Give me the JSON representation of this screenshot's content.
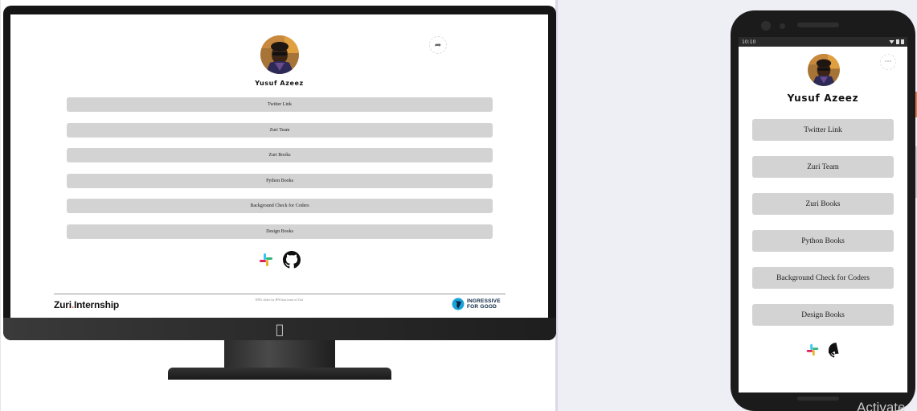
{
  "profile": {
    "name": "Yusuf Azeez"
  },
  "links": [
    {
      "label": "Twitter Link"
    },
    {
      "label": "Zuri Team"
    },
    {
      "label": "Zuri Books"
    },
    {
      "label": "Python Books"
    },
    {
      "label": "Background Check for Coders"
    },
    {
      "label": "Design Books"
    }
  ],
  "socials": [
    {
      "icon": "slack-icon"
    },
    {
      "icon": "github-icon"
    }
  ],
  "footer": {
    "zuri_left": "Zuri",
    "zuri_dot": ".",
    "zuri_right": "Internship",
    "hng_text": "HNG slides by HNGnut.team of Zuri",
    "ingressive_line1": "INGRESSIVE",
    "ingressive_line2": "FOR GOOD"
  },
  "phone_status": {
    "time": "10:10"
  },
  "overlay": {
    "activate_text": "Activate"
  },
  "colors": {
    "link_background": "#d3d3d3",
    "monitor_frame": "#151515",
    "phone_frame": "#1b1b1b",
    "zuri_dot": "#e5533d"
  }
}
